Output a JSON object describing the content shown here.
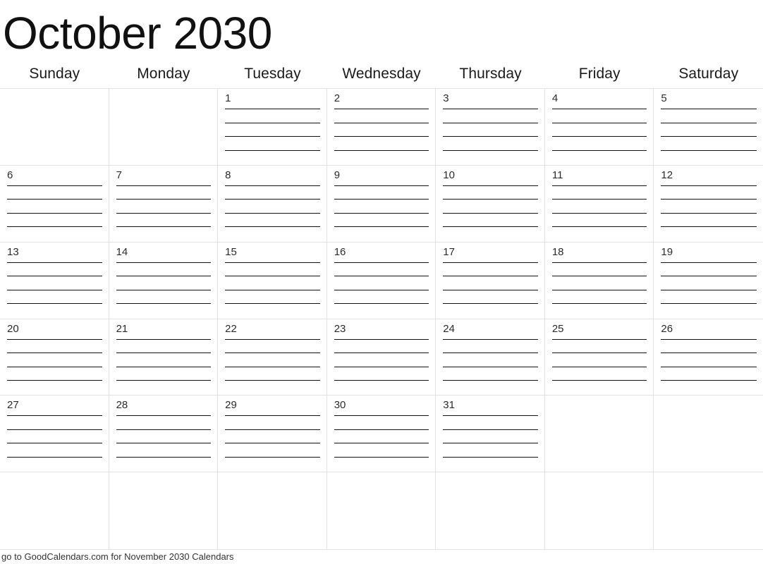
{
  "header": {
    "title": "October 2030",
    "month": "October",
    "year": "2030"
  },
  "weekdays": [
    {
      "label": "Sunday"
    },
    {
      "label": "Monday"
    },
    {
      "label": "Tuesday"
    },
    {
      "label": "Wednesday"
    },
    {
      "label": "Thursday"
    },
    {
      "label": "Friday"
    },
    {
      "label": "Saturday"
    }
  ],
  "grid": {
    "columns": 7,
    "rows": 6,
    "lines_per_day": 4,
    "border_color": "#e2e2e2",
    "rule_color": "#111111",
    "weeks": [
      [
        {
          "date": ""
        },
        {
          "date": ""
        },
        {
          "date": "1"
        },
        {
          "date": "2"
        },
        {
          "date": "3"
        },
        {
          "date": "4"
        },
        {
          "date": "5"
        }
      ],
      [
        {
          "date": "6"
        },
        {
          "date": "7"
        },
        {
          "date": "8"
        },
        {
          "date": "9"
        },
        {
          "date": "10"
        },
        {
          "date": "11"
        },
        {
          "date": "12"
        }
      ],
      [
        {
          "date": "13"
        },
        {
          "date": "14"
        },
        {
          "date": "15"
        },
        {
          "date": "16"
        },
        {
          "date": "17"
        },
        {
          "date": "18"
        },
        {
          "date": "19"
        }
      ],
      [
        {
          "date": "20"
        },
        {
          "date": "21"
        },
        {
          "date": "22"
        },
        {
          "date": "23"
        },
        {
          "date": "24"
        },
        {
          "date": "25"
        },
        {
          "date": "26"
        }
      ],
      [
        {
          "date": "27"
        },
        {
          "date": "28"
        },
        {
          "date": "29"
        },
        {
          "date": "30"
        },
        {
          "date": "31"
        },
        {
          "date": ""
        },
        {
          "date": ""
        }
      ],
      [
        {
          "date": ""
        },
        {
          "date": ""
        },
        {
          "date": ""
        },
        {
          "date": ""
        },
        {
          "date": ""
        },
        {
          "date": ""
        },
        {
          "date": ""
        }
      ]
    ]
  },
  "footer": {
    "text": "go to GoodCalendars.com for November 2030 Calendars"
  }
}
